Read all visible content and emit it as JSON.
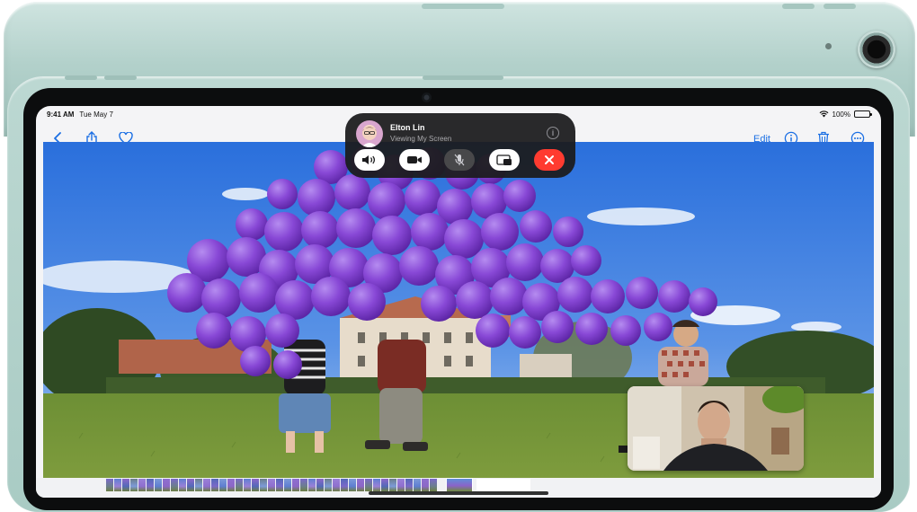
{
  "status_bar": {
    "time": "9:41 AM",
    "date": "Tue May 7",
    "battery_percent": "100%",
    "battery_level": 1.0
  },
  "nav_bar": {
    "left_icons": [
      "back-chevron-icon",
      "share-icon",
      "heart-icon"
    ],
    "edit_label": "Edit",
    "right_icons": [
      "info-icon",
      "trash-icon",
      "more-icon"
    ],
    "accent_color": "#1b6fe4"
  },
  "facetime": {
    "caller_name": "Elton Lin",
    "caller_status": "Viewing My Screen",
    "controls": [
      "speaker-icon",
      "camera-icon",
      "mute-icon",
      "share-screen-icon",
      "end-call-icon"
    ],
    "end_call_color": "#ff3b30"
  },
  "photo": {
    "subject": "children holding purple balloons on a lawn"
  },
  "pip": {
    "label": "self-view"
  }
}
